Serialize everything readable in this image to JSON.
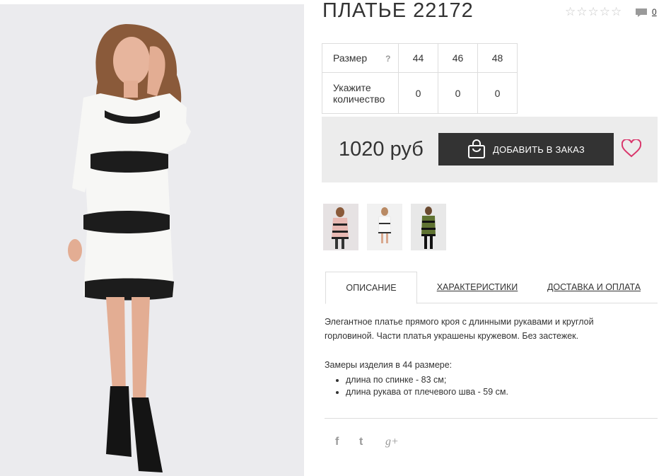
{
  "product": {
    "title": "ПЛАТЬЕ 22172",
    "rating_stars": 5,
    "comments_count": "0"
  },
  "sizes_table": {
    "size_label": "Размер",
    "help_label": "?",
    "sizes": [
      "44",
      "46",
      "48"
    ],
    "qty_label_line1": "Укажите",
    "qty_label_line2": "количество",
    "quantities": [
      "0",
      "0",
      "0"
    ]
  },
  "purchase": {
    "price": "1020 руб",
    "add_button_label": "ДОБАВИТЬ В ЗАКАЗ"
  },
  "thumbnails": [
    {
      "name": "pink-dress-variant"
    },
    {
      "name": "white-dress-variant"
    },
    {
      "name": "green-dress-variant"
    }
  ],
  "tabs": {
    "description": "ОПИСАНИЕ",
    "characteristics": "ХАРАКТЕРИСТИКИ",
    "delivery": "ДОСТАВКА И ОПЛАТА"
  },
  "description": {
    "text": "Элегантное платье прямого кроя с длинными рукавами и круглой горловиной. Части платья украшены кружевом. Без застежек.",
    "measures_title": "Замеры изделия в 44 размере:",
    "measures": [
      "длина по спинке - 83 см;",
      "длина рукава от плечевого шва - 59 см."
    ]
  },
  "social": [
    "f",
    "t",
    "g+"
  ],
  "colors": {
    "dark": "#333333",
    "heart": "#d9366b",
    "photo_bg": "#ebebee"
  }
}
